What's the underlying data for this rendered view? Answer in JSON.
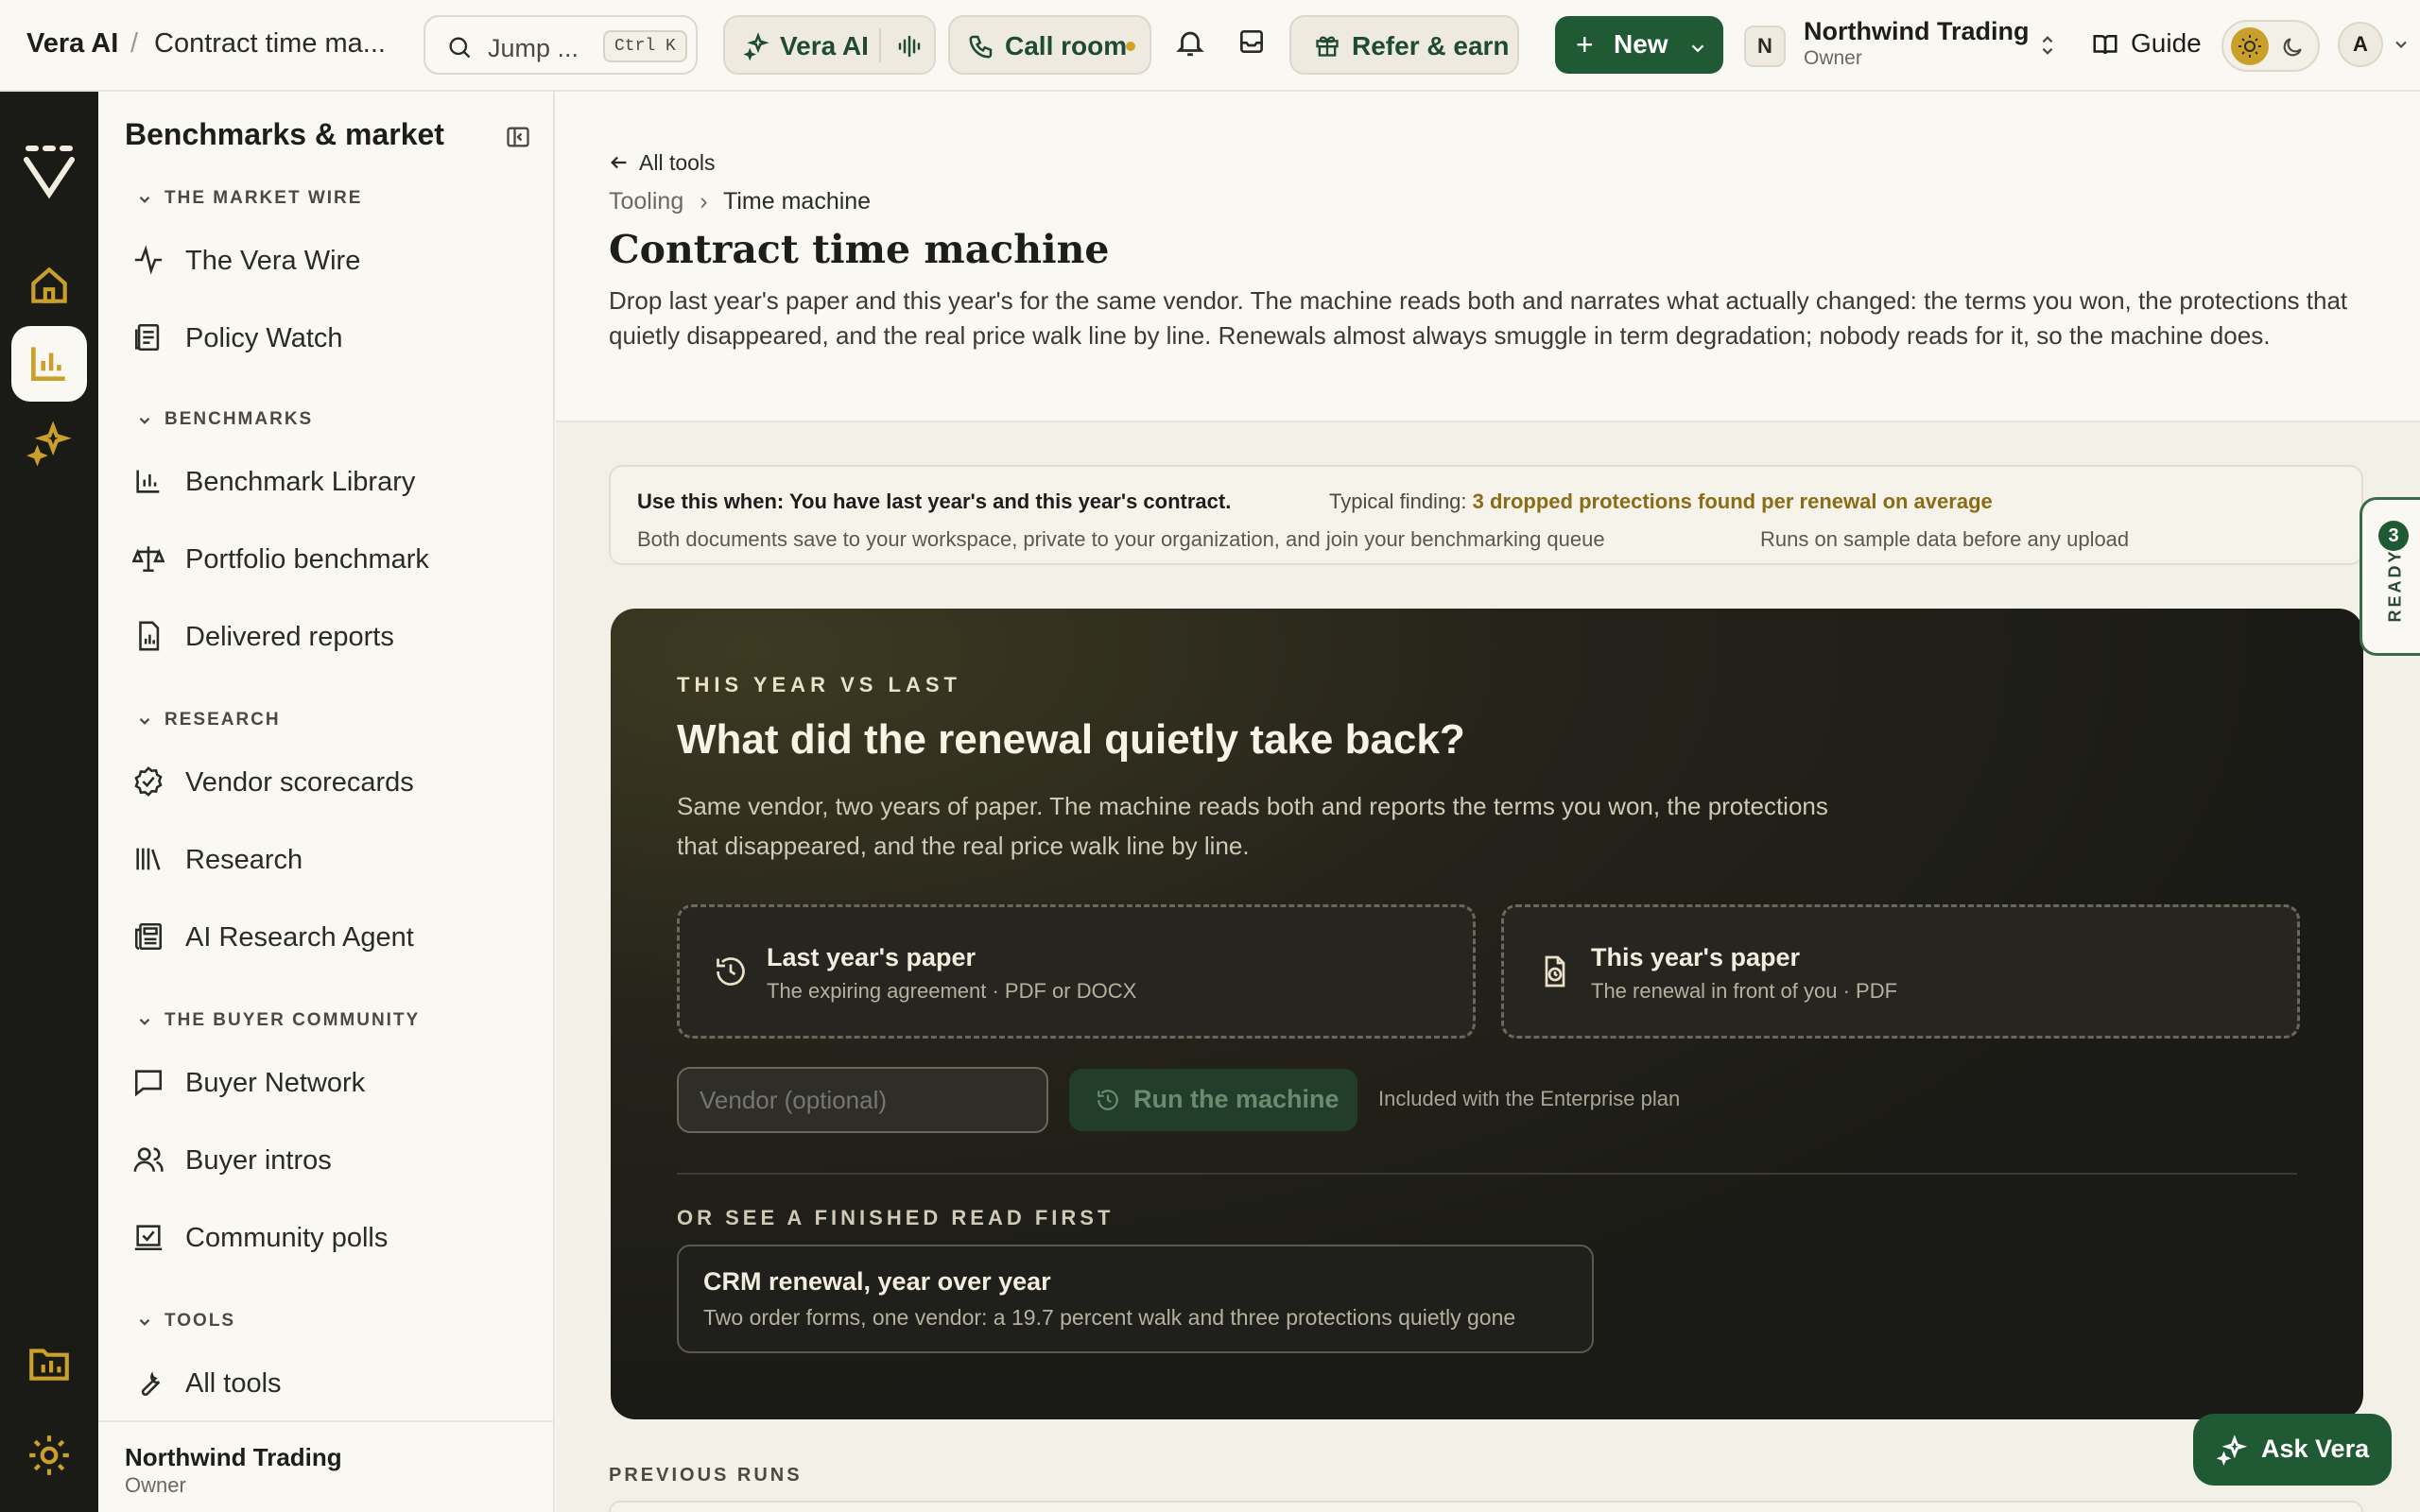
{
  "header": {
    "app_name": "Vera AI",
    "breadcrumb_sep": "/",
    "page_title": "Contract time ma...",
    "search": {
      "placeholder": "Jump ...",
      "shortcut": "Ctrl K"
    },
    "vera_ai_label": "Vera AI",
    "call_room_label": "Call room",
    "refer_label": "Refer & earn",
    "new_label": "New",
    "org": {
      "badge": "N",
      "name": "Northwind Trading",
      "role": "Owner"
    },
    "guide_label": "Guide",
    "avatar_initial": "A",
    "icons": [
      "search-icon",
      "vera-sparkle-icon",
      "waveform-icon",
      "phone-icon",
      "bell-icon",
      "inbox-icon",
      "gift-icon",
      "plus-icon",
      "chevron-down-icon",
      "updown-chevron-icon",
      "book-icon",
      "sun-icon",
      "moon-icon"
    ]
  },
  "rail": {
    "icons": [
      "vera-logo",
      "home-icon",
      "chart-icon",
      "sparkle-icon",
      "folder-chart-icon",
      "settings-icon"
    ],
    "active": "chart-icon"
  },
  "sidebar": {
    "title": "Benchmarks & market",
    "sections": [
      {
        "label": "THE MARKET WIRE",
        "items": [
          {
            "label": "The Vera Wire",
            "icon": "pulse-icon"
          },
          {
            "label": "Policy Watch",
            "icon": "policy-icon"
          }
        ]
      },
      {
        "label": "BENCHMARKS",
        "items": [
          {
            "label": "Benchmark Library",
            "icon": "bar-chart-icon"
          },
          {
            "label": "Portfolio benchmark",
            "icon": "scale-icon"
          },
          {
            "label": "Delivered reports",
            "icon": "report-file-icon"
          }
        ]
      },
      {
        "label": "RESEARCH",
        "items": [
          {
            "label": "Vendor scorecards",
            "icon": "badge-check-icon"
          },
          {
            "label": "Research",
            "icon": "library-icon"
          },
          {
            "label": "AI Research Agent",
            "icon": "newspaper-icon"
          }
        ]
      },
      {
        "label": "THE BUYER COMMUNITY",
        "items": [
          {
            "label": "Buyer Network",
            "icon": "message-square-icon"
          },
          {
            "label": "Buyer intros",
            "icon": "users-icon"
          },
          {
            "label": "Community polls",
            "icon": "poll-icon"
          }
        ]
      },
      {
        "label": "TOOLS",
        "items": [
          {
            "label": "All tools",
            "icon": "wrench-icon"
          }
        ]
      }
    ],
    "footer": {
      "name": "Northwind Trading",
      "role": "Owner"
    }
  },
  "page": {
    "back_label": "All tools",
    "breadcrumb": {
      "parent": "Tooling",
      "sep": "›",
      "current": "Time machine"
    },
    "title": "Contract time machine",
    "description": "Drop last year's paper and this year's for the same vendor. The machine reads both and narrates what actually changed: the terms you won, the protections that quietly disappeared, and the real price walk line by line. Renewals almost always smuggle in term degradation; nobody reads for it, so the machine does."
  },
  "info": {
    "use_when": "Use this when: You have last year's and this year's contract.",
    "typical_prefix": "Typical finding: ",
    "typical_value": "3 dropped protections found per renewal on average",
    "privacy": "Both documents save to your workspace, private to your organization, and join your benchmarking queue",
    "sample_note": "Runs on sample data before any upload"
  },
  "hero": {
    "eyebrow": "THIS YEAR VS LAST",
    "heading": "What did the renewal quietly take back?",
    "body": "Same vendor, two years of paper. The machine reads both and reports the terms you won, the protections that disappeared, and the real price walk line by line.",
    "drop_last": {
      "title": "Last year's paper",
      "sub": "The expiring agreement · PDF or DOCX"
    },
    "drop_this": {
      "title": "This year's paper",
      "sub": "The renewal in front of you · PDF"
    },
    "vendor_placeholder": "Vendor (optional)",
    "run_label": "Run the machine",
    "included": "Included with the Enterprise plan",
    "eyebrow2": "OR SEE A FINISHED READ FIRST",
    "sample": {
      "title": "CRM renewal, year over year",
      "sub": "Two order forms, one vendor: a 19.7 percent walk and three protections quietly gone"
    }
  },
  "ready_tab": {
    "count": "3",
    "label": "READY"
  },
  "previous_runs_label": "PREVIOUS RUNS",
  "ask_label": "Ask Vera",
  "colors": {
    "brand_green": "#1f5a34",
    "gold": "#caa02a",
    "rail": "#1a1a17",
    "background": "#faf8f2"
  }
}
